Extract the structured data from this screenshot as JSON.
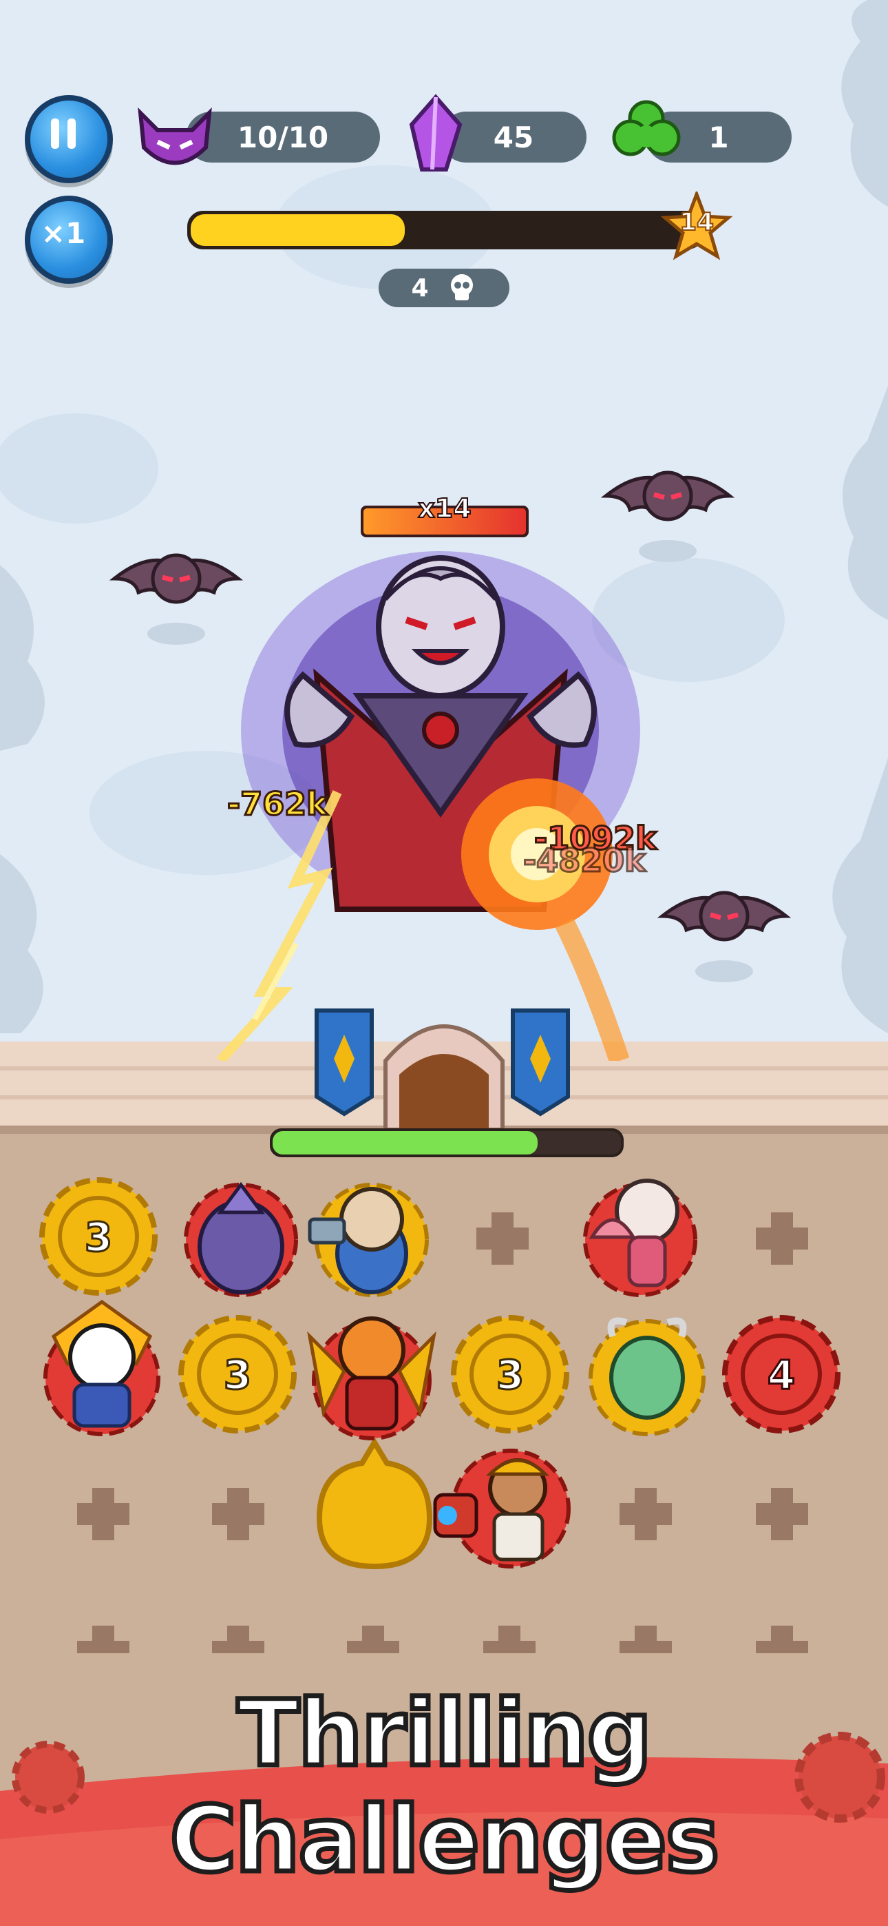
{
  "hud": {
    "pause_icon": "pause-icon",
    "speed_label": "×1",
    "demon_counter": "10/10",
    "crystal_counter": "45",
    "clover_counter": "1",
    "wave_level": "14",
    "wave_progress": 0.42,
    "kill_count": "4"
  },
  "boss": {
    "multiplier": "x14",
    "health_fraction": 1.0
  },
  "damage_numbers": [
    "-762k",
    "-1092k",
    "-4820k"
  ],
  "castle": {
    "health_fraction": 0.76
  },
  "board": {
    "gear_levels": [
      "3",
      "3",
      "3",
      "4"
    ]
  },
  "banner": {
    "title": "Thrilling Challenges"
  },
  "colors": {
    "sky": "#dfeaf6",
    "ground": "#cbb09a",
    "gear_gold": "#f2b810",
    "gear_red": "#e23a34",
    "banner_red": "#e8504c",
    "progress_yellow": "#ffd21f",
    "castle_health_green": "#7de24f"
  }
}
